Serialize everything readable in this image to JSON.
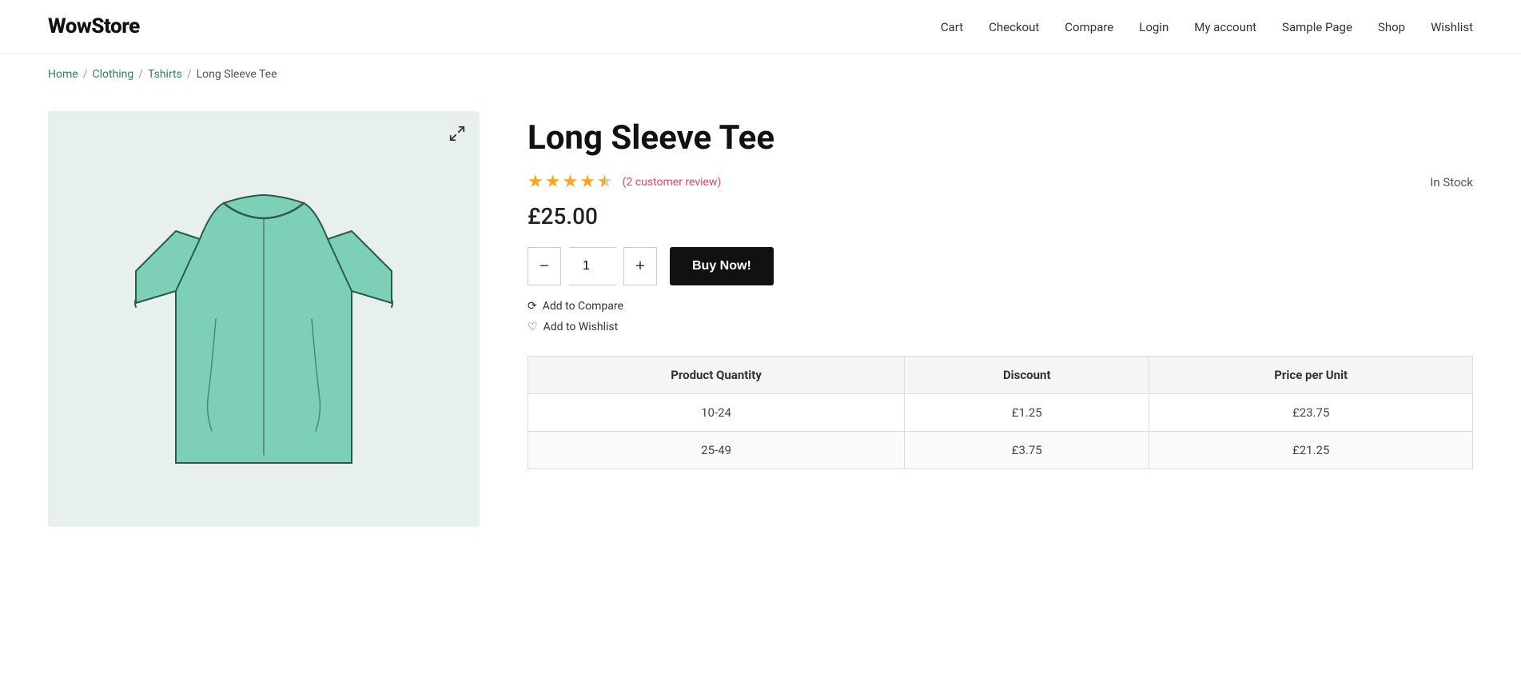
{
  "header": {
    "logo": "WowStore",
    "nav": [
      {
        "label": "Cart",
        "href": "#"
      },
      {
        "label": "Checkout",
        "href": "#"
      },
      {
        "label": "Compare",
        "href": "#"
      },
      {
        "label": "Login",
        "href": "#"
      },
      {
        "label": "My account",
        "href": "#"
      },
      {
        "label": "Sample Page",
        "href": "#"
      },
      {
        "label": "Shop",
        "href": "#"
      },
      {
        "label": "Wishlist",
        "href": "#"
      }
    ]
  },
  "breadcrumb": {
    "home": "Home",
    "clothing": "Clothing",
    "tshirts": "Tshirts",
    "current": "Long Sleeve Tee"
  },
  "product": {
    "title": "Long Sleeve Tee",
    "review_count": "(2 customer review)",
    "stock": "In Stock",
    "price": "£25.00",
    "quantity": "1",
    "buy_label": "Buy Now!",
    "add_to_compare": "Add to Compare",
    "add_to_wishlist": "Add to Wishlist",
    "stars": 4.5
  },
  "pricing_table": {
    "headers": [
      "Product Quantity",
      "Discount",
      "Price per Unit"
    ],
    "rows": [
      {
        "quantity": "10-24",
        "discount": "£1.25",
        "price": "£23.75"
      },
      {
        "quantity": "25-49",
        "discount": "£3.75",
        "price": "£21.25"
      }
    ]
  }
}
